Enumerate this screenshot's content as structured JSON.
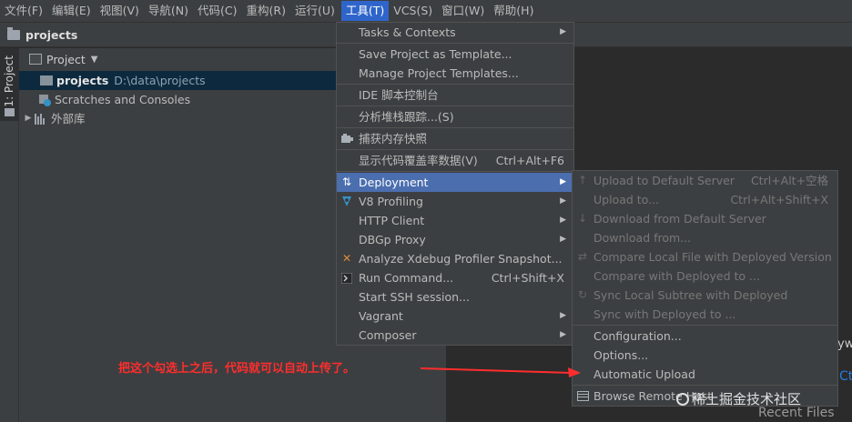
{
  "menubar": {
    "items": [
      "文件(F)",
      "编辑(E)",
      "视图(V)",
      "导航(N)",
      "代码(C)",
      "重构(R)",
      "运行(U)",
      "工具(T)",
      "VCS(S)",
      "窗口(W)",
      "帮助(H)"
    ]
  },
  "navbar": {
    "crumb": "projects"
  },
  "stripe": {
    "tab_label": "1: Project"
  },
  "project_panel": {
    "title": "Project",
    "rows": [
      {
        "name": "projects",
        "path": "D:\\data\\projects"
      },
      {
        "name": "Scratches and Consoles"
      },
      {
        "name": "外部库"
      }
    ]
  },
  "tools_menu": {
    "items": [
      {
        "label": "Tasks & Contexts",
        "shortcut": "",
        "submenu": true
      },
      {
        "label": "Save Project as Template...",
        "shortcut": "",
        "submenu": false
      },
      {
        "label": "Manage Project Templates...",
        "shortcut": "",
        "submenu": false
      },
      {
        "label": "IDE 脚本控制台",
        "shortcut": "",
        "submenu": false
      },
      {
        "label": "分析堆栈跟踪...(S)",
        "shortcut": "",
        "submenu": false
      },
      {
        "label": "捕获内存快照",
        "shortcut": "",
        "submenu": false
      },
      {
        "label": "显示代码覆盖率数据(V)",
        "shortcut": "Ctrl+Alt+F6",
        "submenu": false
      },
      {
        "label": "Deployment",
        "shortcut": "",
        "submenu": true
      },
      {
        "label": "V8 Profiling",
        "shortcut": "",
        "submenu": true
      },
      {
        "label": "HTTP Client",
        "shortcut": "",
        "submenu": true
      },
      {
        "label": "DBGp Proxy",
        "shortcut": "",
        "submenu": true
      },
      {
        "label": "Analyze Xdebug Profiler Snapshot...",
        "shortcut": "",
        "submenu": false
      },
      {
        "label": "Run Command...",
        "shortcut": "Ctrl+Shift+X",
        "submenu": false
      },
      {
        "label": "Start SSH session...",
        "shortcut": "",
        "submenu": false
      },
      {
        "label": "Vagrant",
        "shortcut": "",
        "submenu": true
      },
      {
        "label": "Composer",
        "shortcut": "",
        "submenu": true
      }
    ]
  },
  "deployment_menu": {
    "items": [
      {
        "label": "Upload to Default Server",
        "shortcut": "Ctrl+Alt+空格"
      },
      {
        "label": "Upload to...",
        "shortcut": "Ctrl+Alt+Shift+X"
      },
      {
        "label": "Download from Default Server",
        "shortcut": ""
      },
      {
        "label": "Download from...",
        "shortcut": ""
      },
      {
        "label": "Compare Local File with Deployed Version",
        "shortcut": ""
      },
      {
        "label": "Compare with Deployed to ...",
        "shortcut": ""
      },
      {
        "label": "Sync Local Subtree with Deployed",
        "shortcut": ""
      },
      {
        "label": "Sync with Deployed to ...",
        "shortcut": ""
      },
      {
        "label": "Configuration...",
        "shortcut": ""
      },
      {
        "label": "Options...",
        "shortcut": ""
      },
      {
        "label": "Automatic Upload",
        "shortcut": ""
      },
      {
        "label": "Browse Remote Host",
        "shortcut": ""
      }
    ]
  },
  "editor": {
    "fragment_1": "yw",
    "fragment_2": "Ct",
    "recent_files": "Recent Files"
  },
  "annotation": {
    "text": "把这个勾选上之后，代码就可以自动上传了。"
  },
  "watermark": {
    "text": "稀土掘金技术社区"
  },
  "colors": {
    "highlight": "#4b6eaf",
    "menubar_active": "#2f65ca",
    "annotation": "#ff2d2d"
  }
}
